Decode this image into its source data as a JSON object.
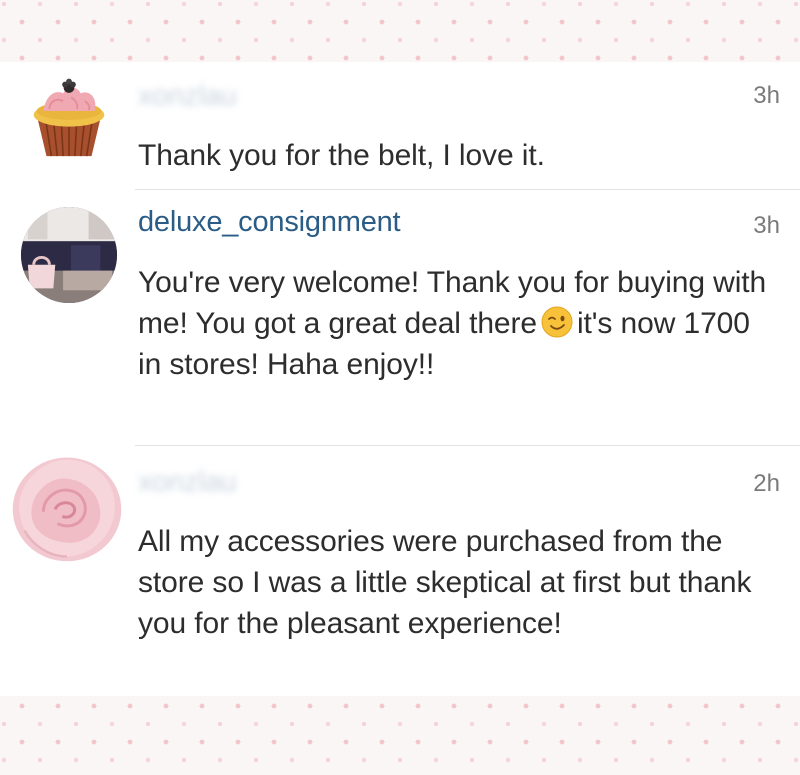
{
  "comments": [
    {
      "username": "xonzlau",
      "time": "3h",
      "text": "Thank you for the belt, I love it.",
      "avatar_icon": "cupcake-icon"
    },
    {
      "username": "deluxe_consignment",
      "time": "3h",
      "text_before_emoji": "You're very welcome! Thank you for buying with me! You got a great deal there",
      "emoji": "winking-face-emoji",
      "text_after_emoji": "it's now 1700 in stores! Haha enjoy!!",
      "avatar_icon": "boutique-photo-avatar"
    },
    {
      "username": "xonzlau",
      "time": "2h",
      "text": "All my accessories were purchased from the store so I was a little skeptical at first but thank you for the pleasant experience!",
      "avatar_icon": "pink-rose-icon"
    }
  ],
  "colors": {
    "username": "#2a5c86",
    "timestamp": "#7a7a7a",
    "body_text": "#2d2d2d",
    "background_dots": "#f3c6cc"
  }
}
